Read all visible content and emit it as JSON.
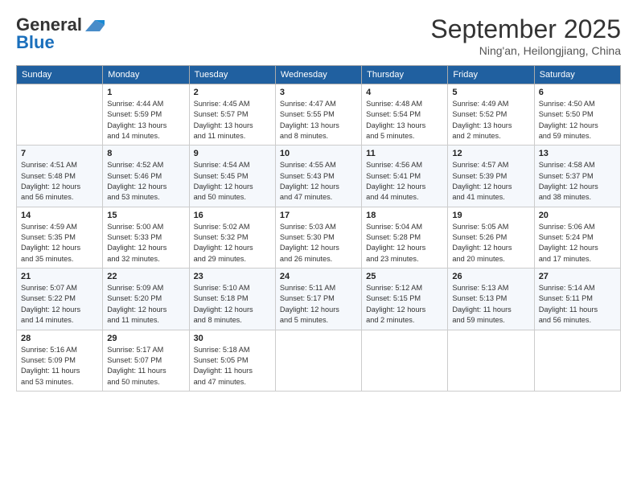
{
  "logo": {
    "general": "General",
    "blue": "Blue"
  },
  "header": {
    "month": "September 2025",
    "location": "Ning'an, Heilongjiang, China"
  },
  "weekdays": [
    "Sunday",
    "Monday",
    "Tuesday",
    "Wednesday",
    "Thursday",
    "Friday",
    "Saturday"
  ],
  "weeks": [
    [
      {
        "day": null
      },
      {
        "day": 1,
        "info": "Sunrise: 4:44 AM\nSunset: 5:59 PM\nDaylight: 13 hours\nand 14 minutes."
      },
      {
        "day": 2,
        "info": "Sunrise: 4:45 AM\nSunset: 5:57 PM\nDaylight: 13 hours\nand 11 minutes."
      },
      {
        "day": 3,
        "info": "Sunrise: 4:47 AM\nSunset: 5:55 PM\nDaylight: 13 hours\nand 8 minutes."
      },
      {
        "day": 4,
        "info": "Sunrise: 4:48 AM\nSunset: 5:54 PM\nDaylight: 13 hours\nand 5 minutes."
      },
      {
        "day": 5,
        "info": "Sunrise: 4:49 AM\nSunset: 5:52 PM\nDaylight: 13 hours\nand 2 minutes."
      },
      {
        "day": 6,
        "info": "Sunrise: 4:50 AM\nSunset: 5:50 PM\nDaylight: 12 hours\nand 59 minutes."
      }
    ],
    [
      {
        "day": 7,
        "info": "Sunrise: 4:51 AM\nSunset: 5:48 PM\nDaylight: 12 hours\nand 56 minutes."
      },
      {
        "day": 8,
        "info": "Sunrise: 4:52 AM\nSunset: 5:46 PM\nDaylight: 12 hours\nand 53 minutes."
      },
      {
        "day": 9,
        "info": "Sunrise: 4:54 AM\nSunset: 5:45 PM\nDaylight: 12 hours\nand 50 minutes."
      },
      {
        "day": 10,
        "info": "Sunrise: 4:55 AM\nSunset: 5:43 PM\nDaylight: 12 hours\nand 47 minutes."
      },
      {
        "day": 11,
        "info": "Sunrise: 4:56 AM\nSunset: 5:41 PM\nDaylight: 12 hours\nand 44 minutes."
      },
      {
        "day": 12,
        "info": "Sunrise: 4:57 AM\nSunset: 5:39 PM\nDaylight: 12 hours\nand 41 minutes."
      },
      {
        "day": 13,
        "info": "Sunrise: 4:58 AM\nSunset: 5:37 PM\nDaylight: 12 hours\nand 38 minutes."
      }
    ],
    [
      {
        "day": 14,
        "info": "Sunrise: 4:59 AM\nSunset: 5:35 PM\nDaylight: 12 hours\nand 35 minutes."
      },
      {
        "day": 15,
        "info": "Sunrise: 5:00 AM\nSunset: 5:33 PM\nDaylight: 12 hours\nand 32 minutes."
      },
      {
        "day": 16,
        "info": "Sunrise: 5:02 AM\nSunset: 5:32 PM\nDaylight: 12 hours\nand 29 minutes."
      },
      {
        "day": 17,
        "info": "Sunrise: 5:03 AM\nSunset: 5:30 PM\nDaylight: 12 hours\nand 26 minutes."
      },
      {
        "day": 18,
        "info": "Sunrise: 5:04 AM\nSunset: 5:28 PM\nDaylight: 12 hours\nand 23 minutes."
      },
      {
        "day": 19,
        "info": "Sunrise: 5:05 AM\nSunset: 5:26 PM\nDaylight: 12 hours\nand 20 minutes."
      },
      {
        "day": 20,
        "info": "Sunrise: 5:06 AM\nSunset: 5:24 PM\nDaylight: 12 hours\nand 17 minutes."
      }
    ],
    [
      {
        "day": 21,
        "info": "Sunrise: 5:07 AM\nSunset: 5:22 PM\nDaylight: 12 hours\nand 14 minutes."
      },
      {
        "day": 22,
        "info": "Sunrise: 5:09 AM\nSunset: 5:20 PM\nDaylight: 12 hours\nand 11 minutes."
      },
      {
        "day": 23,
        "info": "Sunrise: 5:10 AM\nSunset: 5:18 PM\nDaylight: 12 hours\nand 8 minutes."
      },
      {
        "day": 24,
        "info": "Sunrise: 5:11 AM\nSunset: 5:17 PM\nDaylight: 12 hours\nand 5 minutes."
      },
      {
        "day": 25,
        "info": "Sunrise: 5:12 AM\nSunset: 5:15 PM\nDaylight: 12 hours\nand 2 minutes."
      },
      {
        "day": 26,
        "info": "Sunrise: 5:13 AM\nSunset: 5:13 PM\nDaylight: 11 hours\nand 59 minutes."
      },
      {
        "day": 27,
        "info": "Sunrise: 5:14 AM\nSunset: 5:11 PM\nDaylight: 11 hours\nand 56 minutes."
      }
    ],
    [
      {
        "day": 28,
        "info": "Sunrise: 5:16 AM\nSunset: 5:09 PM\nDaylight: 11 hours\nand 53 minutes."
      },
      {
        "day": 29,
        "info": "Sunrise: 5:17 AM\nSunset: 5:07 PM\nDaylight: 11 hours\nand 50 minutes."
      },
      {
        "day": 30,
        "info": "Sunrise: 5:18 AM\nSunset: 5:05 PM\nDaylight: 11 hours\nand 47 minutes."
      },
      {
        "day": null
      },
      {
        "day": null
      },
      {
        "day": null
      },
      {
        "day": null
      }
    ]
  ]
}
